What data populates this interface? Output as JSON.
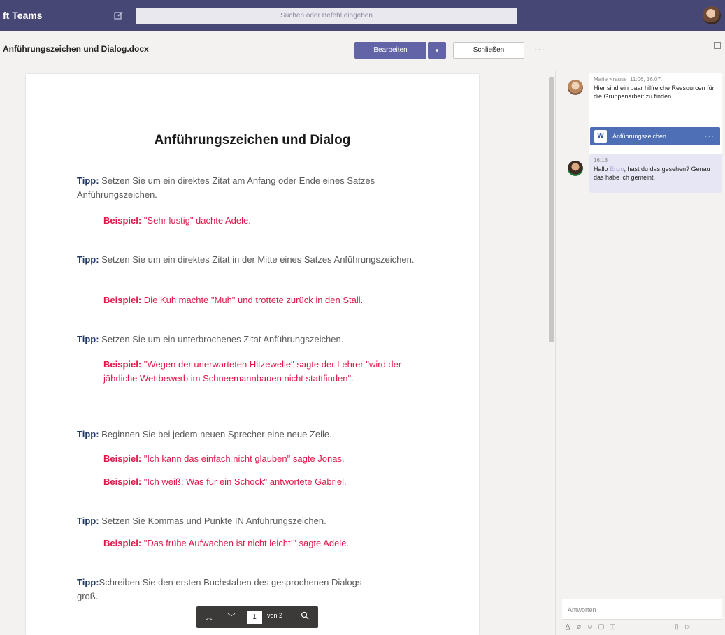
{
  "app": {
    "name": "ft Teams"
  },
  "search": {
    "placeholder": "Suchen oder Befehl eingeben"
  },
  "doc_header": {
    "title": "Anführungszeichen und Dialog.docx",
    "edit_label": "Bearbeiten",
    "close_label": "Schließen",
    "more_label": "···"
  },
  "document": {
    "heading": "Anführungszeichen und Dialog",
    "tip_label": "Tipp:",
    "example_label": "Beispiel:",
    "tips": [
      {
        "text": " Setzen Sie um ein direktes Zitat am Anfang oder Ende eines Satzes Anführungszeichen.",
        "examples": [
          " \"Sehr lustig\" dachte Adele."
        ]
      },
      {
        "text": " Setzen Sie um ein direktes Zitat in der Mitte eines Satzes Anführungszeichen.",
        "examples": [
          " Die Kuh machte \"Muh\" und trottete zurück in den Stall."
        ]
      },
      {
        "text": " Setzen Sie um ein unterbrochenes Zitat Anführungszeichen.",
        "examples": [
          " \"Wegen der unerwarteten Hitzewelle\" sagte der Lehrer \"wird der jährliche Wettbewerb im Schneemannbauen nicht stattfinden\"."
        ]
      },
      {
        "text": " Beginnen Sie bei jedem neuen Sprecher eine neue Zeile.",
        "examples": [
          " \"Ich kann das einfach nicht glauben\" sagte Jonas.",
          " \"Ich weiß: Was für ein Schock\" antwortete Gabriel."
        ]
      },
      {
        "text": " Setzen Sie Kommas und Punkte IN Anführungszeichen.",
        "examples": [
          " \"Das frühe Aufwachen ist nicht leicht!\" sagte Adele."
        ]
      },
      {
        "text": "Schreiben Sie den ersten Buchstaben des gesprochenen Dialogs groß.",
        "examples": []
      }
    ]
  },
  "page_nav": {
    "current": "1",
    "of_label": "von 2"
  },
  "chat": {
    "messages": [
      {
        "author": "Marie Krause",
        "time": "11:06, 16.07.",
        "text": "Hier sind ein paar hilfreiche Ressourcen für die Gruppenarbeit zu finden.",
        "file": "Anführungszeichen..."
      },
      {
        "time": "16:18",
        "text_before": "Hallo ",
        "mention": "Enzo",
        "text_after": ", hast du das gesehen? Genau das habe ich gemeint."
      }
    ],
    "reply_placeholder": "Antworten"
  }
}
